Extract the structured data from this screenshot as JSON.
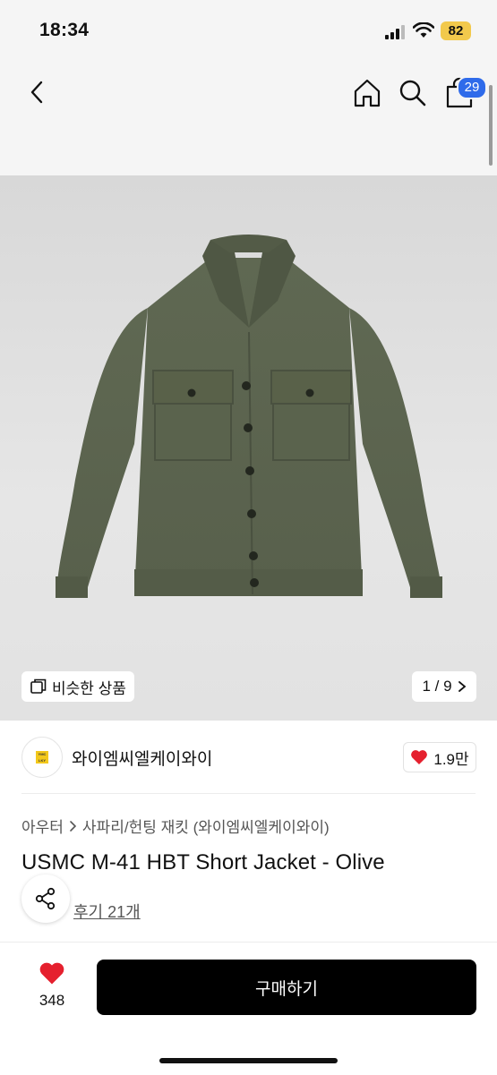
{
  "status": {
    "time": "18:34",
    "battery": "82"
  },
  "header": {
    "cart_count": "29"
  },
  "image": {
    "similar_label": "비슷한 상품",
    "pager": "1 / 9"
  },
  "brand": {
    "name": "와이엠씨엘케이와이",
    "likes": "1.9만",
    "logo_text": "YMC LKY"
  },
  "breadcrumb": {
    "category": "아우터",
    "subcategory": "사파리/헌팅 재킷 (와이엠씨엘케이와이)"
  },
  "product": {
    "title": "USMC M-41 HBT Short Jacket - Olive",
    "reviews": "후기 21개"
  },
  "bottom": {
    "wish_count": "348",
    "buy_label": "구매하기"
  },
  "colors": {
    "accent_blue": "#2f6bea",
    "heart_red": "#e5202e",
    "battery_yellow": "#f2c94c",
    "jacket_olive": "#5d6650"
  },
  "icons": [
    "back-icon",
    "home-icon",
    "search-icon",
    "bag-icon",
    "similar-icon",
    "chevron-right-icon",
    "heart-icon",
    "share-icon"
  ]
}
